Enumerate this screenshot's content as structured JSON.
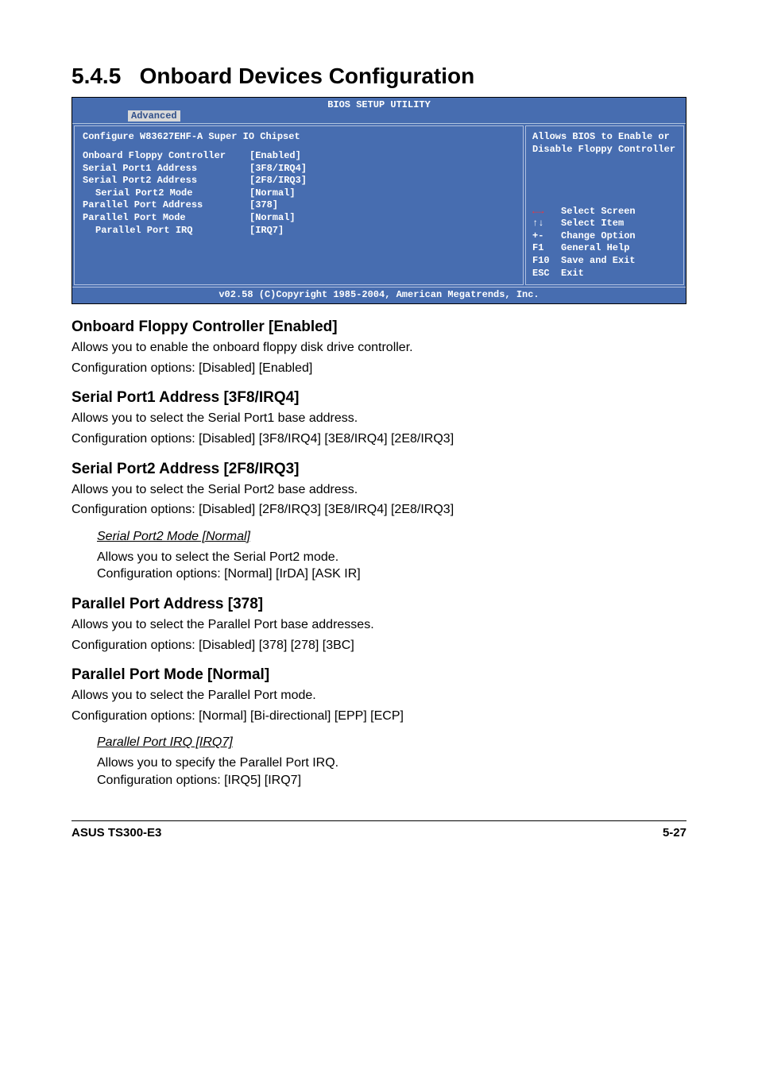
{
  "section": {
    "number": "5.4.5",
    "title": "Onboard Devices Configuration"
  },
  "bios": {
    "title": "BIOS SETUP UTILITY",
    "tab": "Advanced",
    "config_header": "Configure W83627EHF-A Super IO Chipset",
    "rows": [
      {
        "label": "Onboard Floppy Controller",
        "value": "[Enabled]",
        "indent": false
      },
      {
        "label": "Serial Port1 Address",
        "value": "[3F8/IRQ4]",
        "indent": false
      },
      {
        "label": "Serial Port2 Address",
        "value": "[2F8/IRQ3]",
        "indent": false
      },
      {
        "label": "Serial Port2 Mode",
        "value": "[Normal]",
        "indent": true
      },
      {
        "label": "Parallel Port Address",
        "value": "[378]",
        "indent": false
      },
      {
        "label": "Parallel Port Mode",
        "value": "[Normal]",
        "indent": false
      },
      {
        "label": "Parallel Port IRQ",
        "value": "[IRQ7]",
        "indent": true
      }
    ],
    "help_text": "Allows BIOS to Enable or Disable Floppy Controller",
    "nav": {
      "select_screen": "Select Screen",
      "select_item": "Select Item",
      "change_option_key": "+-",
      "change_option": "Change Option",
      "general_help_key": "F1",
      "general_help": "General Help",
      "save_exit_key": "F10",
      "save_exit": "Save and Exit",
      "esc_key": "ESC",
      "esc": "Exit"
    },
    "footer": "v02.58 (C)Copyright 1985-2004, American Megatrends, Inc."
  },
  "content": {
    "floppy": {
      "heading": "Onboard Floppy Controller [Enabled]",
      "line1": "Allows you to enable the onboard floppy disk drive controller.",
      "line2": "Configuration options: [Disabled] [Enabled]"
    },
    "serial1": {
      "heading": "Serial Port1 Address [3F8/IRQ4]",
      "line1": "Allows you to select the Serial Port1 base address.",
      "line2": "Configuration options: [Disabled] [3F8/IRQ4] [3E8/IRQ4] [2E8/IRQ3]"
    },
    "serial2": {
      "heading": "Serial Port2 Address [2F8/IRQ3]",
      "line1": "Allows you to select the Serial Port2 base address.",
      "line2": "Configuration options: [Disabled] [2F8/IRQ3] [3E8/IRQ4] [2E8/IRQ3]"
    },
    "serial2mode": {
      "heading": "Serial Port2 Mode [Normal]",
      "line1": "Allows you to select the Serial Port2 mode.",
      "line2": "Configuration options: [Normal] [IrDA] [ASK IR]"
    },
    "paralleladdr": {
      "heading": "Parallel Port Address [378]",
      "line1": "Allows you to select the Parallel Port base addresses.",
      "line2": "Configuration options: [Disabled] [378] [278] [3BC]"
    },
    "parallelmode": {
      "heading": "Parallel Port Mode [Normal]",
      "line1": "Allows you to select the Parallel Port mode.",
      "line2": "Configuration options: [Normal] [Bi-directional] [EPP] [ECP]"
    },
    "parallelirq": {
      "heading": "Parallel Port IRQ [IRQ7]",
      "line1": "Allows you to specify the Parallel Port IRQ.",
      "line2": "Configuration options: [IRQ5] [IRQ7]"
    }
  },
  "footer": {
    "left": "ASUS TS300-E3",
    "right": "5-27"
  }
}
